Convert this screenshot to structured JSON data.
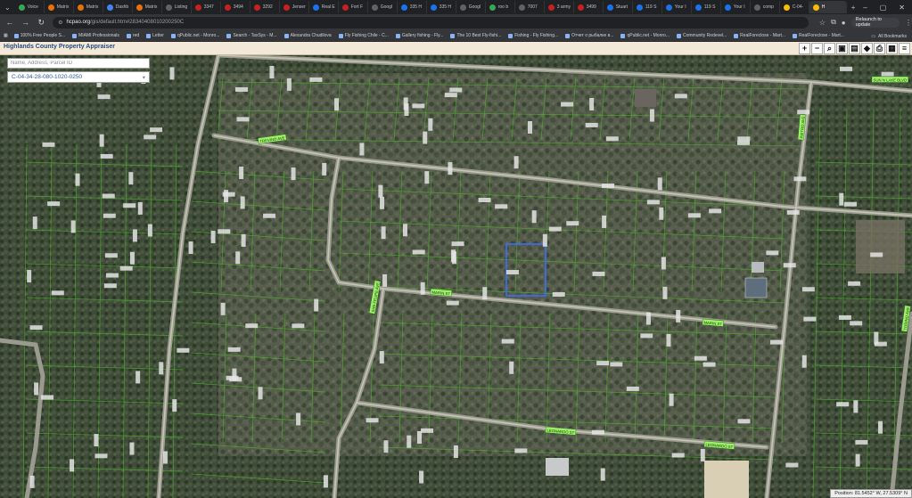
{
  "tabs": [
    {
      "label": "Voice",
      "color": "#34a853"
    },
    {
      "label": "Matrix",
      "color": "#e8710a"
    },
    {
      "label": "Matrix",
      "color": "#e8710a"
    },
    {
      "label": "Dashb",
      "color": "#4285f4"
    },
    {
      "label": "Matrix",
      "color": "#e8710a"
    },
    {
      "label": "Listing",
      "color": "#5f6368"
    },
    {
      "label": "3347",
      "color": "#c5221f"
    },
    {
      "label": "3494",
      "color": "#c5221f"
    },
    {
      "label": "3292",
      "color": "#c5221f"
    },
    {
      "label": "Jenser",
      "color": "#c5221f"
    },
    {
      "label": "Real E",
      "color": "#1a73e8"
    },
    {
      "label": "Fort F",
      "color": "#c5221f"
    },
    {
      "label": "Googl",
      "color": "#5f6368"
    },
    {
      "label": "335 H",
      "color": "#1a73e8"
    },
    {
      "label": "335 H",
      "color": "#1a73e8"
    },
    {
      "label": "Googl",
      "color": "#5f6368"
    },
    {
      "label": "roo b",
      "color": "#34a853"
    },
    {
      "label": "7007",
      "color": "#5f6368"
    },
    {
      "label": "3 army",
      "color": "#c5221f"
    },
    {
      "label": "3499",
      "color": "#c5221f"
    },
    {
      "label": "Stuart",
      "color": "#1a73e8"
    },
    {
      "label": "119 S",
      "color": "#1a73e8"
    },
    {
      "label": "Your I",
      "color": "#1a73e8"
    },
    {
      "label": "119 S",
      "color": "#1a73e8"
    },
    {
      "label": "Your I",
      "color": "#1a73e8"
    },
    {
      "label": "comp",
      "color": "#5f6368"
    },
    {
      "label": "C-04-",
      "color": "#fbbc04"
    },
    {
      "label": "H",
      "color": "#fbbc04",
      "active": true
    }
  ],
  "address": {
    "host": "hcpao.org",
    "path": "/gis/default.htm#28340408010200250C",
    "relaunch_label": "Relaunch to update"
  },
  "bookmarks": [
    "100% Free People S...",
    "MIAMI Professionals",
    "red",
    "Letter",
    "qPublic.net - Monro...",
    "Search - TaxSys - M...",
    "Alexandra Chudilova",
    "Fly Fishing Chile - C...",
    "Gallery fishing - Fly...",
    "The 10 Best Fly-fishi...",
    "Fishing - Fly Fishing...",
    "Отчет о рыбалке в...",
    "qPublic.net - Monro...",
    "Community Redevel...",
    "RealForeclose - Mart...",
    "RealForeclose - Mart..."
  ],
  "all_bookmarks_label": "All Bookmarks",
  "site": {
    "title": "Highlands County Property Appraiser"
  },
  "tools": [
    {
      "icon": "zoom-in-icon",
      "glyph": "+"
    },
    {
      "icon": "zoom-out-icon",
      "glyph": "−"
    },
    {
      "icon": "zoom-box-icon",
      "glyph": "⌕"
    },
    {
      "icon": "layer-icon",
      "glyph": "▣"
    },
    {
      "icon": "identify-icon",
      "glyph": "▤"
    },
    {
      "icon": "measure-icon",
      "glyph": "◆"
    },
    {
      "icon": "print-icon",
      "glyph": "⎙"
    },
    {
      "icon": "aerial-icon",
      "glyph": "▦"
    },
    {
      "icon": "menu-icon",
      "glyph": "≡"
    }
  ],
  "search": {
    "placeholder": "Name, Address, Parcel ID",
    "selected_parcel": "C-04-34-28-080-1020-0250"
  },
  "streets": [
    "TREVINO AVE",
    "MARIN ST",
    "MARIN ST",
    "LEONARDO ST",
    "LEONARDO ST",
    "PIETRO AVE",
    "SAN FELIPE AVE",
    "SUN N LAKE BLVD",
    "TORINO AVE"
  ],
  "coordinates": "Position: 81.5452° W, 27.5309° N",
  "colors": {
    "parcel_lines": "#4caf2a",
    "selected_parcel": "#3b6cff",
    "street_label_bg": "#9ff06b"
  }
}
